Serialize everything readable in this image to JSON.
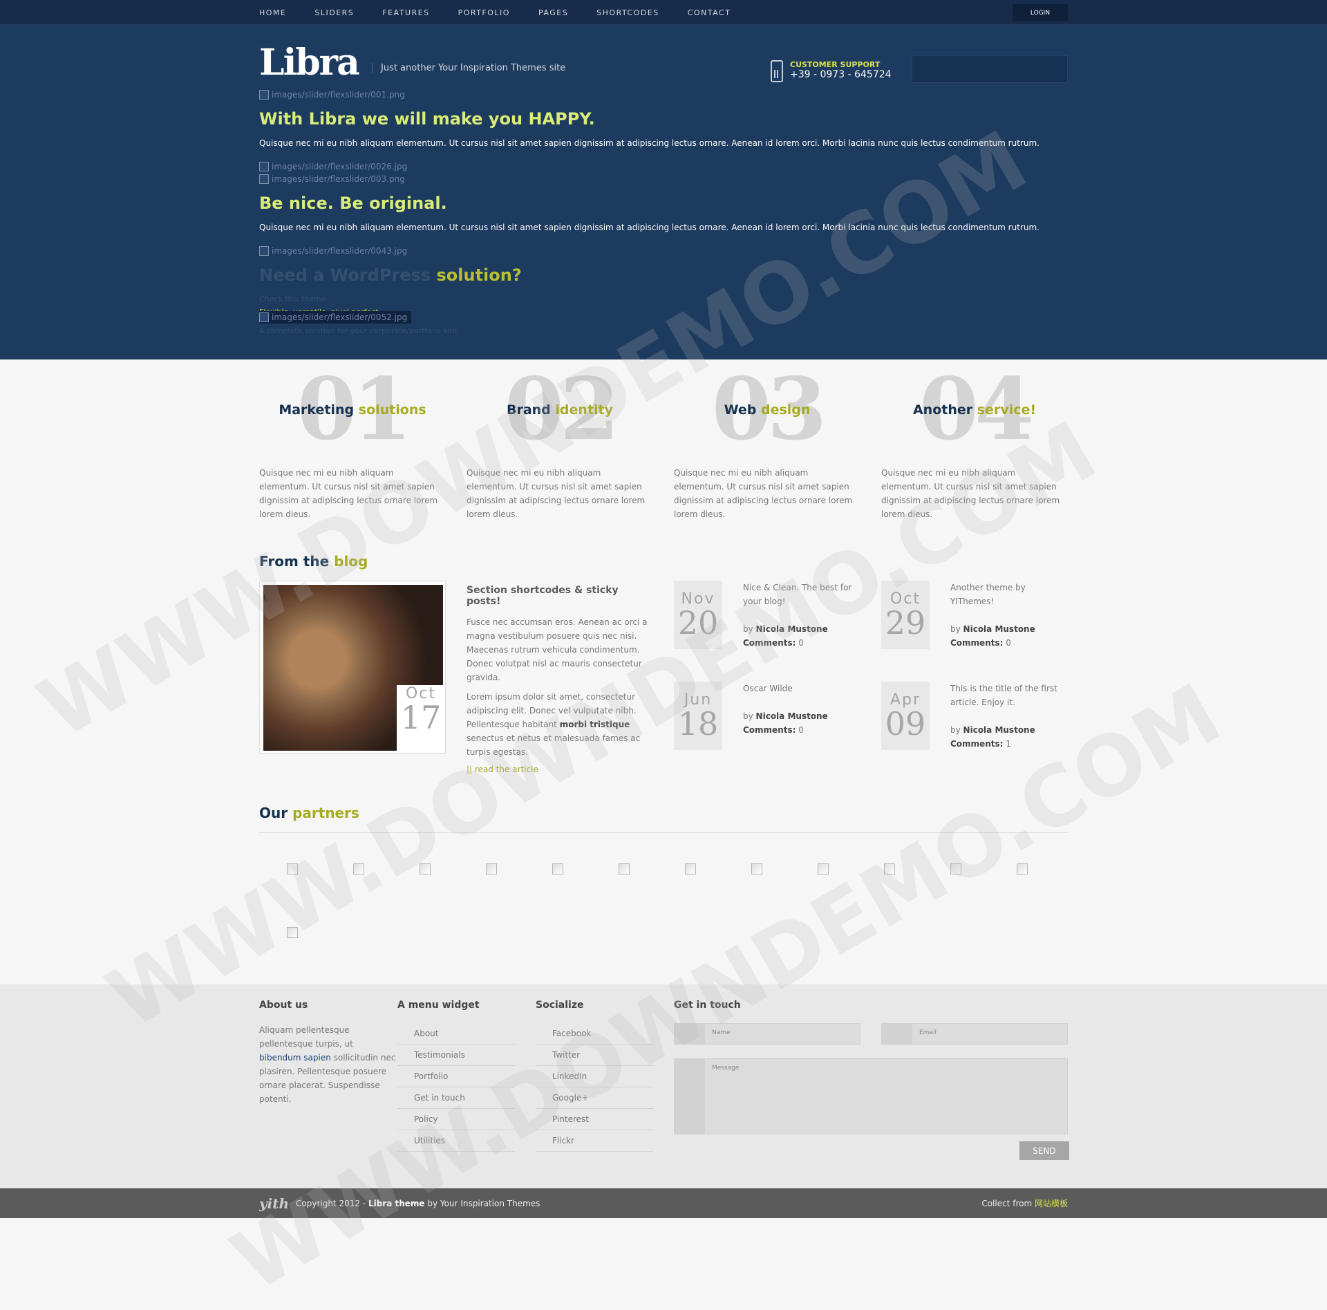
{
  "nav": {
    "items": [
      "HOME",
      "SLIDERS",
      "FEATURES",
      "PORTFOLIO",
      "PAGES",
      "SHORTCODES",
      "CONTACT"
    ],
    "login": "LOGIN"
  },
  "header": {
    "logo": "Libra",
    "tagline": "Just another Your Inspiration Themes site",
    "support_label": "CUSTOMER SUPPORT",
    "support_phone": "+39 - 0973 - 645724"
  },
  "slider": {
    "img1": "images/slider/flexslider/001.png",
    "h1": "With Libra we will make you HAPPY.",
    "p1": "Quisque nec mi eu nibh aliquam elementum. Ut cursus nisl sit amet sapien dignissim at adipiscing lectus ornare. Aenean id lorem orci. Morbi lacinia nunc quis lectus condimentum rutrum.",
    "img2": "images/slider/flexslider/0026.jpg",
    "img3": "images/slider/flexslider/003.png",
    "h2": "Be nice. Be original.",
    "p2": "Quisque nec mi eu nibh aliquam elementum. Ut cursus nisl sit amet sapien dignissim at adipiscing lectus ornare. Aenean id lorem orci. Morbi lacinia nunc quis lectus condimentum rutrum.",
    "img4": "images/slider/flexslider/0043.jpg",
    "h3a": "Need a WordPress",
    "h3b": "solution?",
    "l1": "Check this theme:",
    "l2": "Flexible, versatile, pixel perfect.",
    "l3": "A complete solution for your corporate/portfolio site",
    "img5": "images/slider/flexslider/0052.jpg"
  },
  "services": [
    {
      "num": "01",
      "a": "Marketing",
      "b": "solutions",
      "text": "Quisque nec mi eu nibh aliquam elementum. Ut cursus nisl sit amet sapien dignissim at adipiscing lectus ornare lorem lorem dieus."
    },
    {
      "num": "02",
      "a": "Brand",
      "b": "identity",
      "text": "Quisque nec mi eu nibh aliquam elementum. Ut cursus nisl sit amet sapien dignissim at adipiscing lectus ornare lorem lorem dieus."
    },
    {
      "num": "03",
      "a": "Web",
      "b": "design",
      "text": "Quisque nec mi eu nibh aliquam elementum. Ut cursus nisl sit amet sapien dignissim at adipiscing lectus ornare lorem lorem dieus."
    },
    {
      "num": "04",
      "a": "Another",
      "b": "service!",
      "text": "Quisque nec mi eu nibh aliquam elementum. Ut cursus nisl sit amet sapien dignissim at adipiscing lectus ornare lorem lorem dieus."
    }
  ],
  "blog": {
    "title_a": "From the",
    "title_b": "blog",
    "featured": {
      "month": "Oct",
      "day": "17",
      "title": "Section shortcodes & sticky posts!",
      "p1": "Fusce nec accumsan eros. Aenean ac orci a magna vestibulum posuere quis nec nisi. Maecenas rutrum vehicula condimentum. Donec volutpat nisl ac mauris consectetur gravida.",
      "p2a": "Lorem ipsum dolor sit amet, consectetur adipiscing elit. Donec vel vulputate nibh. Pellentesque habitant ",
      "p2b": "morbi tristique",
      "p2c": " senectus et netus et malesuada fames ac turpis egestas.",
      "read": "|| read the article"
    },
    "posts": [
      {
        "month": "Nov",
        "day": "20",
        "title": "Nice & Clean. The best for your blog!",
        "by": "by",
        "author": "Nicola Mustone",
        "comments_label": "Comments:",
        "comments": "0"
      },
      {
        "month": "Oct",
        "day": "29",
        "title": "Another theme by YIThemes!",
        "by": "by",
        "author": "Nicola Mustone",
        "comments_label": "Comments:",
        "comments": "0"
      },
      {
        "month": "Jun",
        "day": "18",
        "title": "Oscar Wilde",
        "by": "by",
        "author": "Nicola Mustone",
        "comments_label": "Comments:",
        "comments": "0"
      },
      {
        "month": "Apr",
        "day": "09",
        "title": "This is the title of the first article. Enjoy it.",
        "by": "by",
        "author": "Nicola Mustone",
        "comments_label": "Comments:",
        "comments": "1"
      }
    ]
  },
  "partners": {
    "title_a": "Our",
    "title_b": "partners"
  },
  "footer": {
    "about_title": "About us",
    "about_a": "Aliquam pellentesque pellentesque turpis, ut ",
    "about_link": "bibendum sapien",
    "about_b": " sollicitudin nec plasiren. Pellentesque posuere ornare placerat. Suspendisse potenti.",
    "menu_title": "A menu widget",
    "menu": [
      "About",
      "Testimonials",
      "Portfolio",
      "Get in touch",
      "Policy",
      "Utilities"
    ],
    "social_title": "Socialize",
    "social": [
      "Facebook",
      "Twitter",
      "LinkedIn",
      "Google+",
      "Pinterest",
      "Flickr"
    ],
    "contact_title": "Get in touch",
    "name_ph": "Name",
    "email_ph": "Email",
    "message_ph": "Message",
    "send": "SEND"
  },
  "bottom": {
    "copy_a": "Copyright 2012 - ",
    "copy_b": "Libra theme",
    "copy_c": " by Your Inspiration Themes",
    "yith": "yith",
    "collect": "Collect from ",
    "collect_link": "网站模板"
  }
}
